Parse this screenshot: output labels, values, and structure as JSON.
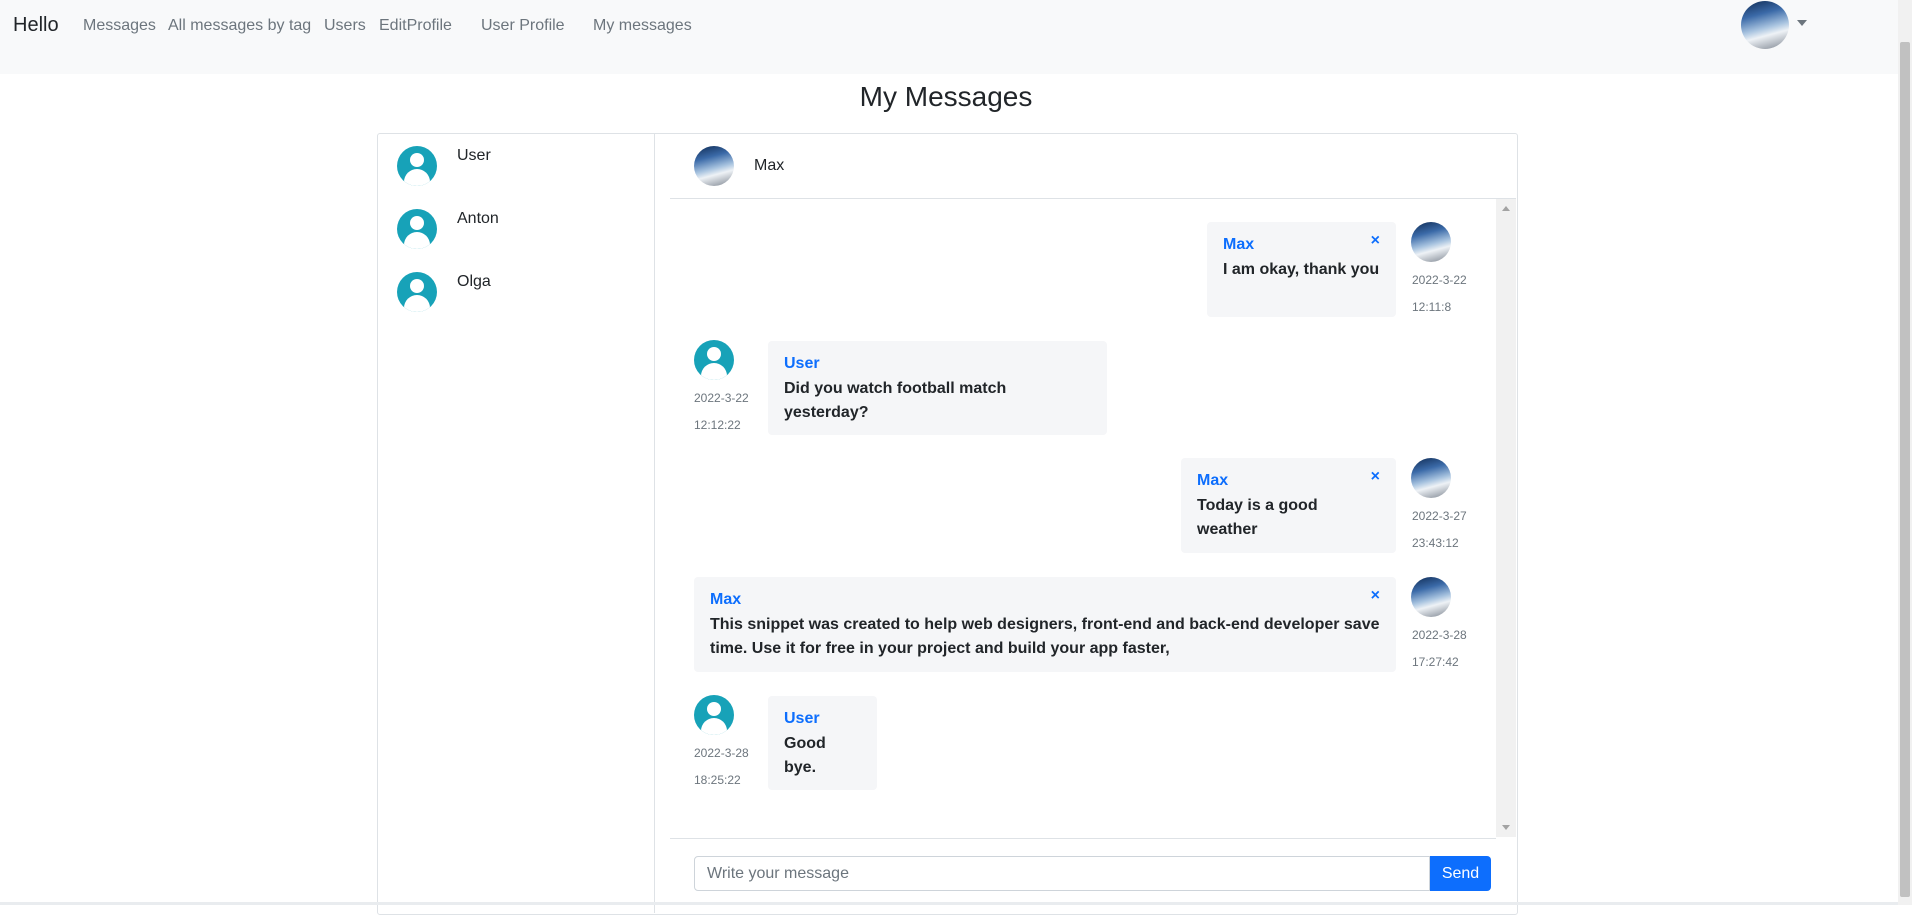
{
  "navbar": {
    "brand": "Hello",
    "links": [
      "Messages",
      "All messages by tag",
      "Users",
      "EditProfile",
      "User Profile",
      "My messages"
    ]
  },
  "page": {
    "title": "My Messages"
  },
  "contacts": [
    {
      "name": "User"
    },
    {
      "name": "Anton"
    },
    {
      "name": "Olga"
    }
  ],
  "chat": {
    "active_contact": "Max",
    "messages": [
      {
        "sender": "Max",
        "text": "I am okay, thank you",
        "date": "2022-3-22",
        "time": "12:11:8",
        "mine": true
      },
      {
        "sender": "User",
        "text": "Did you watch football match yesterday?",
        "date": "2022-3-22",
        "time": "12:12:22",
        "mine": false
      },
      {
        "sender": "Max",
        "text": "Today is a good weather",
        "date": "2022-3-27",
        "time": "23:43:12",
        "mine": true
      },
      {
        "sender": "Max",
        "text": "This snippet was created to help web designers, front-end and back-end developer save time. Use it for free in your project and build your app faster,",
        "date": "2022-3-28",
        "time": "17:27:42",
        "mine": true
      },
      {
        "sender": "User",
        "text": "Good bye.",
        "date": "2022-3-28",
        "time": "18:25:22",
        "mine": false
      }
    ],
    "delete_label": "×"
  },
  "composer": {
    "placeholder": "Write your message",
    "send_label": "Send"
  },
  "colors": {
    "link_blue": "#0d6efd",
    "avatar_teal": "#17a2b8",
    "bubble_bg": "#f5f6f8"
  }
}
